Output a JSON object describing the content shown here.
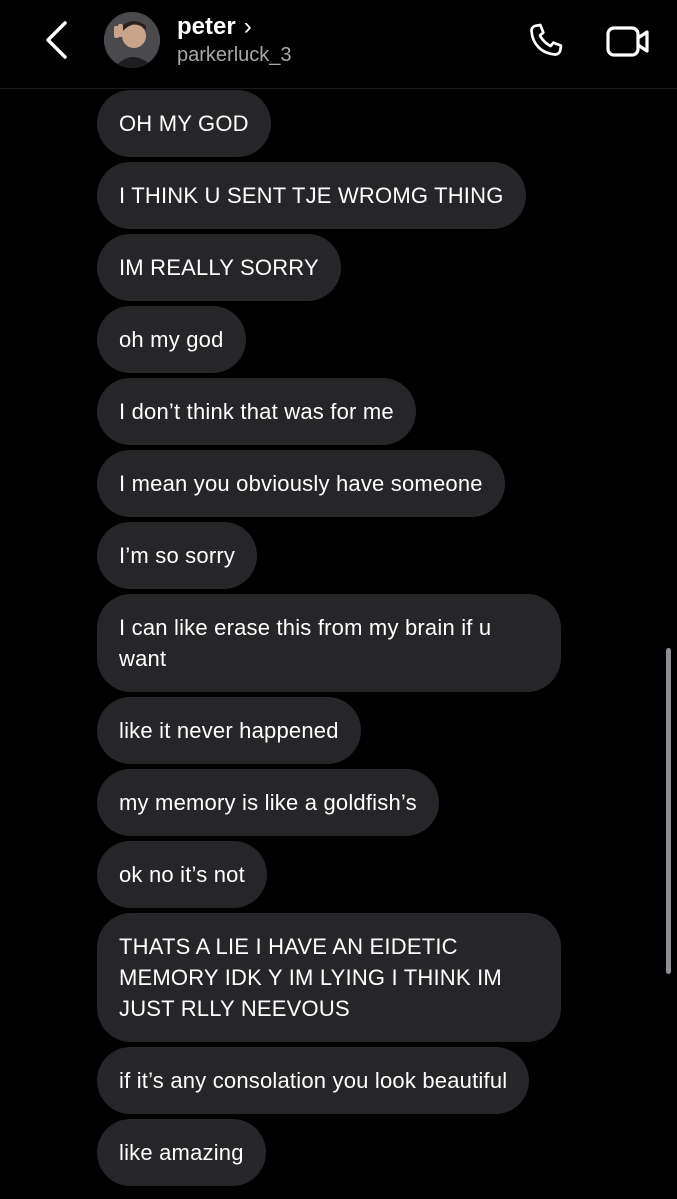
{
  "header": {
    "name": "peter",
    "chevron": "›",
    "username": "parkerluck_3",
    "icons": {
      "back": "chevron-left-icon",
      "call": "phone-icon",
      "video": "video-camera-icon"
    }
  },
  "colors": {
    "background": "#000000",
    "bubble": "#262628",
    "text": "#ffffff",
    "secondary_text": "#a8a8a8"
  },
  "messages": [
    {
      "text": "OH MY GOD"
    },
    {
      "text": "I THINK U SENT TJE WROMG THING"
    },
    {
      "text": "IM REALLY SORRY"
    },
    {
      "text": "oh my god"
    },
    {
      "text": "I don’t think that was for me"
    },
    {
      "text": "I mean you obviously have someone"
    },
    {
      "text": "I’m so sorry"
    },
    {
      "text": "I can like erase this from my brain if u want"
    },
    {
      "text": "like it never happened"
    },
    {
      "text": "my memory is like a goldfish’s"
    },
    {
      "text": "ok no it’s not"
    },
    {
      "text": "THATS A LIE I HAVE AN EIDETIC MEMORY IDK Y IM LYING I THINK IM JUST RLLY NEEVOUS"
    },
    {
      "text": "if it’s any consolation you look beautiful"
    },
    {
      "text": "like amazing"
    }
  ]
}
